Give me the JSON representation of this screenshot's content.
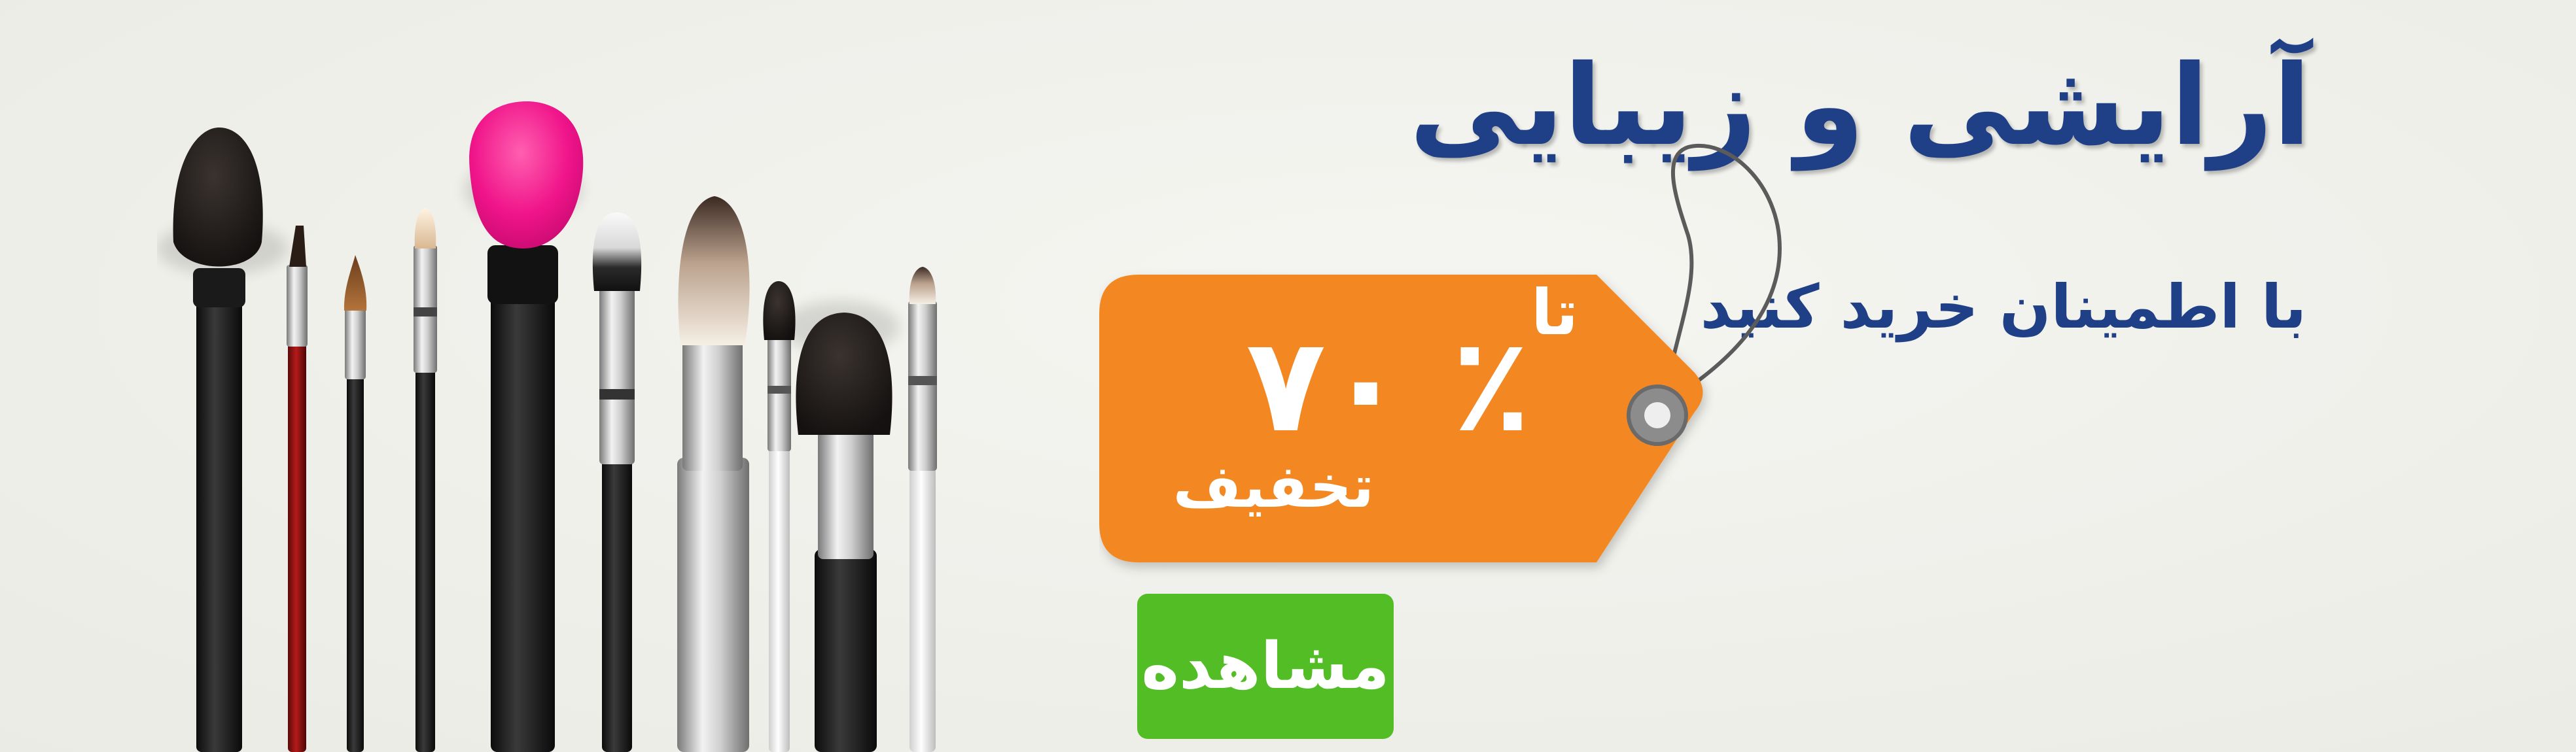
{
  "banner": {
    "headline": "آرایشی و زیبایی",
    "subheadline": "با اطمینان خرید کنید",
    "colors": {
      "background": "#f0f0eb",
      "headline": "#1f3f86",
      "tag": "#f38821",
      "button": "#52bd24",
      "text_on_accent": "#ffffff"
    },
    "image_semantics": "makeup-brushes-image"
  },
  "tag": {
    "prefix": "تا",
    "percent": "٪ ۷۰",
    "label": "تخفیف",
    "icon": "price-tag-icon"
  },
  "button": {
    "label": "مشاهده"
  }
}
